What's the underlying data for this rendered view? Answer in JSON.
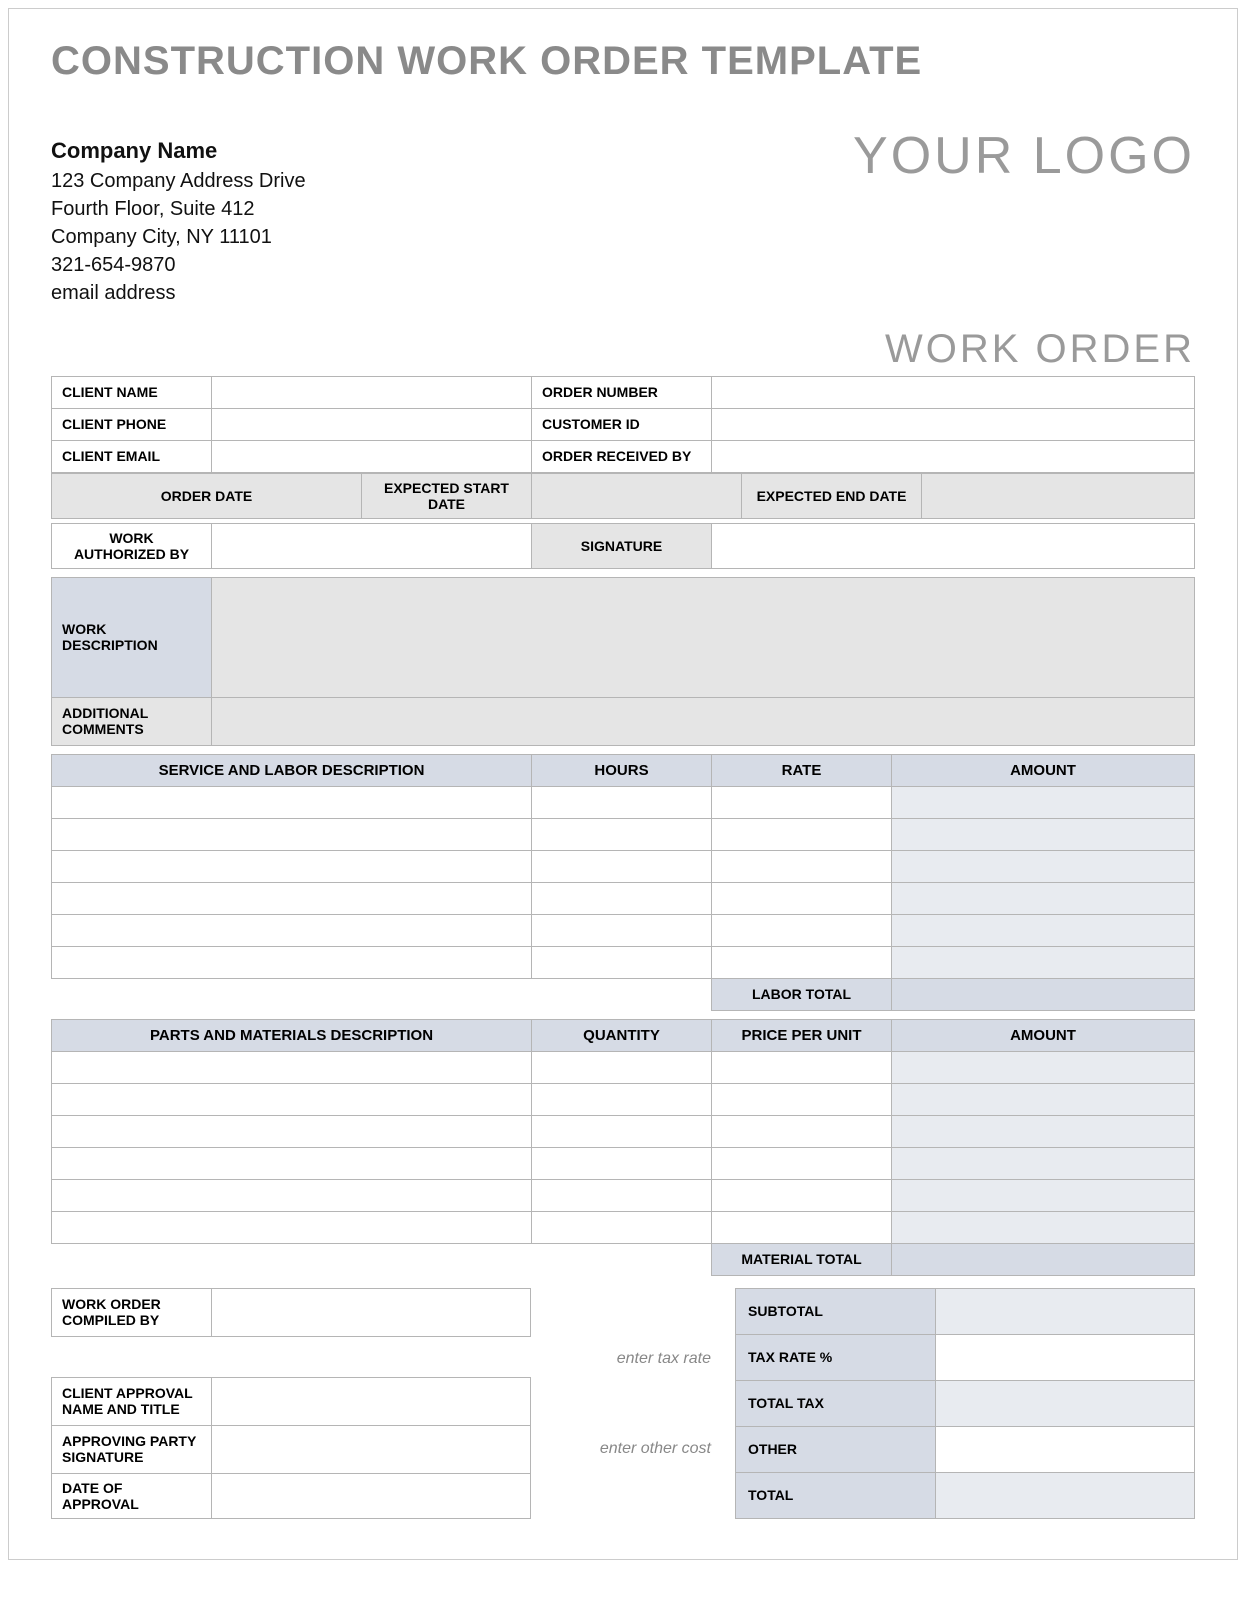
{
  "title": "CONSTRUCTION WORK ORDER TEMPLATE",
  "company": {
    "name": "Company Name",
    "address1": "123 Company Address Drive",
    "address2": "Fourth Floor, Suite 412",
    "city": "Company City, NY  11101",
    "phone": "321-654-9870",
    "email": "email address"
  },
  "logo_text": "YOUR LOGO",
  "doc_label": "WORK ORDER",
  "client_section": {
    "client_name": "CLIENT NAME",
    "client_phone": "CLIENT PHONE",
    "client_email": "CLIENT EMAIL",
    "order_number": "ORDER NUMBER",
    "customer_id": "CUSTOMER ID",
    "order_received_by": "ORDER RECEIVED BY",
    "order_date": "ORDER DATE",
    "expected_start": "EXPECTED START DATE",
    "expected_end": "EXPECTED END DATE",
    "work_auth_by": "WORK AUTHORIZED BY",
    "signature": "SIGNATURE"
  },
  "desc_section": {
    "work_desc": "WORK DESCRIPTION",
    "additional": "ADDITIONAL COMMENTS"
  },
  "labor_table": {
    "header_desc": "SERVICE AND LABOR DESCRIPTION",
    "header_hours": "HOURS",
    "header_rate": "RATE",
    "header_amount": "AMOUNT",
    "labor_total": "LABOR TOTAL"
  },
  "materials_table": {
    "header_desc": "PARTS AND MATERIALS DESCRIPTION",
    "header_qty": "QUANTITY",
    "header_price": "PRICE PER UNIT",
    "header_amount": "AMOUNT",
    "material_total": "MATERIAL TOTAL"
  },
  "compile_section": {
    "compiled_by": "WORK ORDER COMPILED BY",
    "client_approval": "CLIENT APPROVAL NAME AND TITLE",
    "approving_sig": "APPROVING PARTY SIGNATURE",
    "date_approval": "DATE OF APPROVAL"
  },
  "hints": {
    "tax_rate": "enter tax rate",
    "other_cost": "enter other cost"
  },
  "totals": {
    "subtotal": "SUBTOTAL",
    "tax_rate_pct": "TAX RATE %",
    "total_tax": "TOTAL TAX",
    "other": "OTHER",
    "total": "TOTAL"
  }
}
